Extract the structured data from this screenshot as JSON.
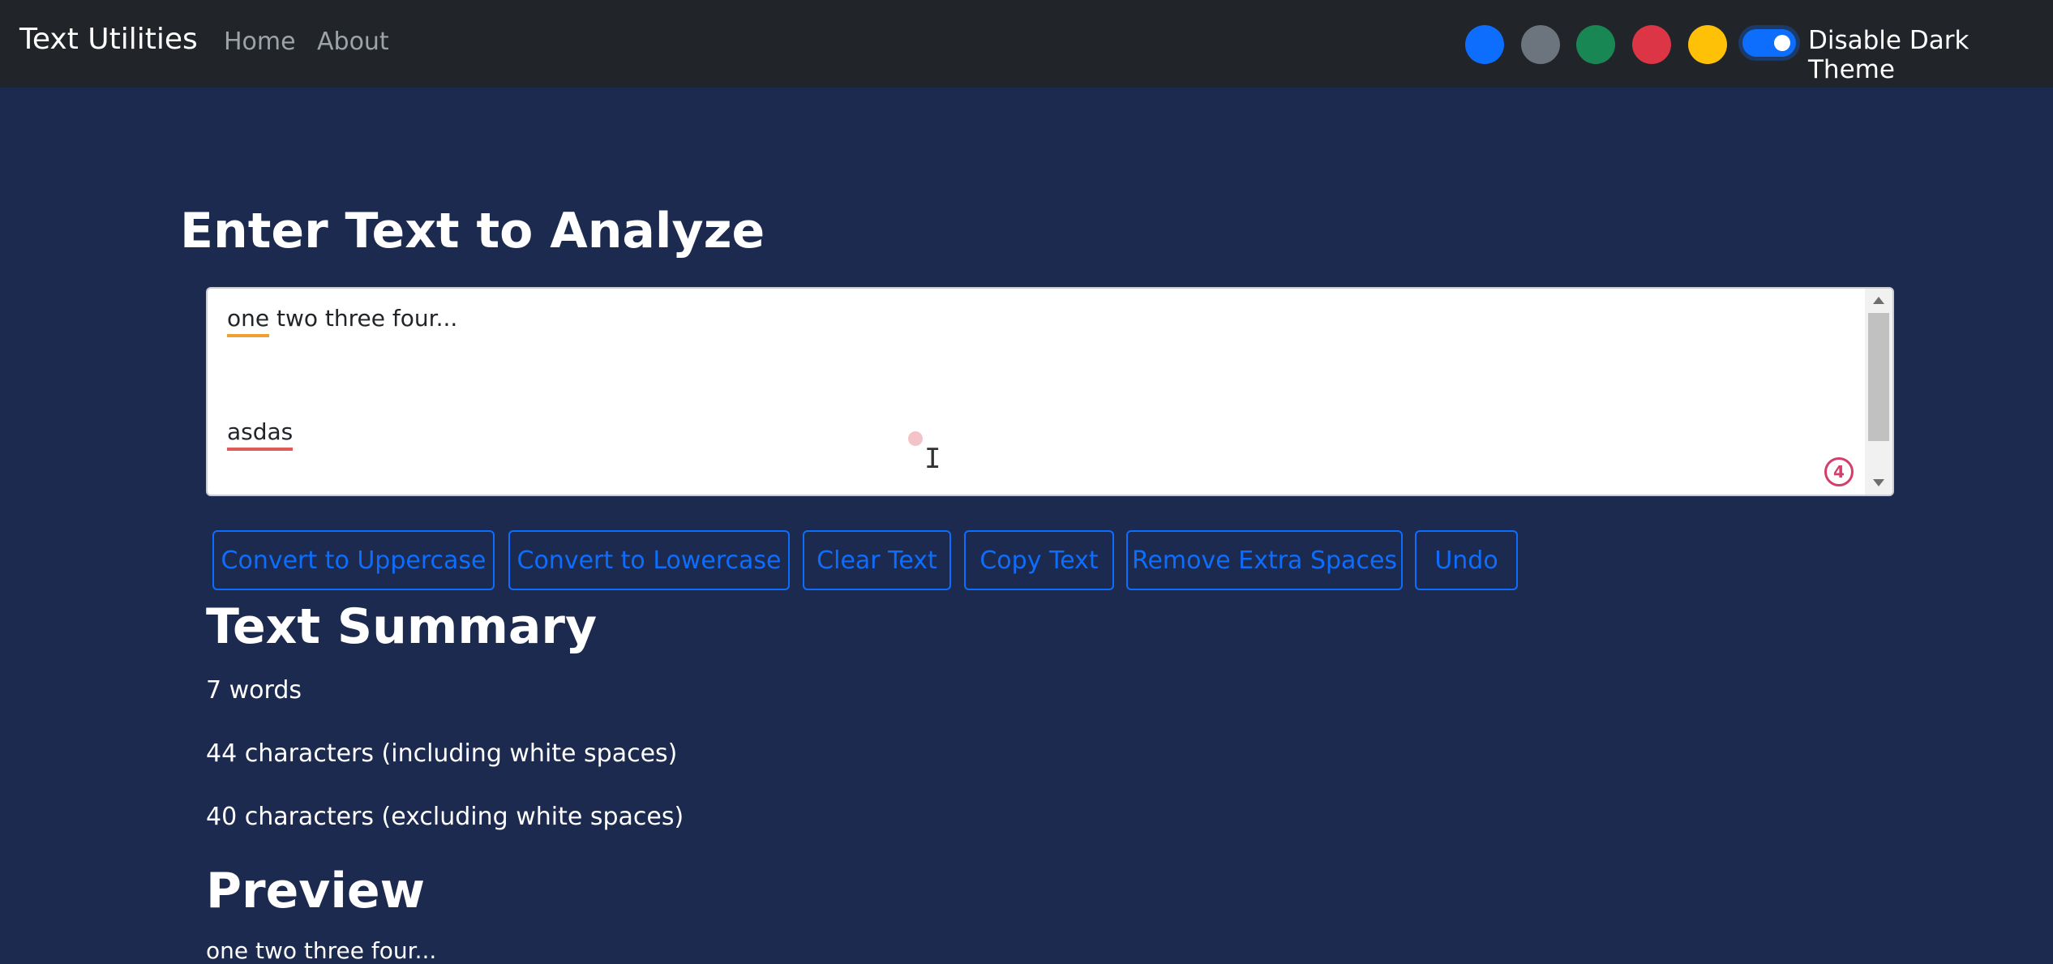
{
  "navbar": {
    "brand": "Text Utilities",
    "links": [
      "Home",
      "About"
    ],
    "swatches": [
      "#0d6efd",
      "#6c757d",
      "#198754",
      "#dc3545",
      "#ffc107"
    ],
    "toggle_label": "Disable Dark Theme",
    "toggle_on": true
  },
  "main": {
    "heading": "Enter Text to Analyze",
    "textarea": {
      "line1": "one two three four...",
      "line2": "asdas",
      "badge": "4"
    },
    "buttons": [
      "Convert to Uppercase",
      "Convert to Lowercase",
      "Clear Text",
      "Copy Text",
      "Remove Extra Spaces",
      "Undo"
    ]
  },
  "summary": {
    "heading": "Text Summary",
    "words": "7 words",
    "chars_with_spaces": "44 characters (including white spaces)",
    "chars_without_spaces": "40 characters (excluding white spaces)"
  },
  "preview": {
    "heading": "Preview"
  },
  "colors": {
    "page_background": "#1c2a4f",
    "navbar_background": "#212529",
    "accent": "#0d6efd"
  }
}
